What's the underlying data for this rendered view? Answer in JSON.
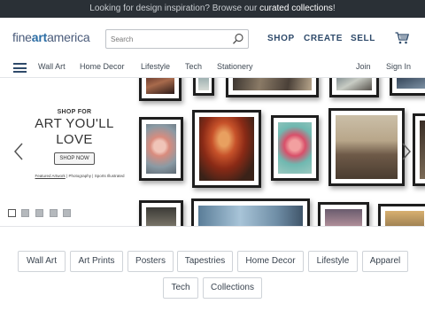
{
  "promo": {
    "text": "Looking for design inspiration?   Browse our ",
    "link": "curated collections",
    "suffix": "!"
  },
  "logo": {
    "part1": "fine",
    "part2": "art",
    "part3": "america"
  },
  "search": {
    "placeholder": "Search",
    "value": ""
  },
  "header_nav": {
    "shop": "SHOP",
    "create": "CREATE",
    "sell": "SELL"
  },
  "nav": {
    "items": [
      "Wall Art",
      "Home Decor",
      "Lifestyle",
      "Tech",
      "Stationery"
    ],
    "join": "Join",
    "sign_in": "Sign In"
  },
  "hero": {
    "eyebrow": "SHOP FOR",
    "title_line1": "ART YOU'LL",
    "title_line2": "LOVE",
    "button": "SHOP NOW",
    "links": [
      "Featured Artwork",
      "Photography",
      "Sports Illustrated"
    ],
    "separator": "|",
    "slide_count": 5,
    "active_slide": 1
  },
  "categories": [
    "Wall Art",
    "Art Prints",
    "Posters",
    "Tapestries",
    "Home Decor",
    "Lifestyle",
    "Apparel",
    "Tech",
    "Collections"
  ],
  "colors": {
    "promo_bg": "#2a3036",
    "logo_blue": "#2d6ea5",
    "nav_dark": "#2f4b6b",
    "frame": "#1e1e1e"
  }
}
